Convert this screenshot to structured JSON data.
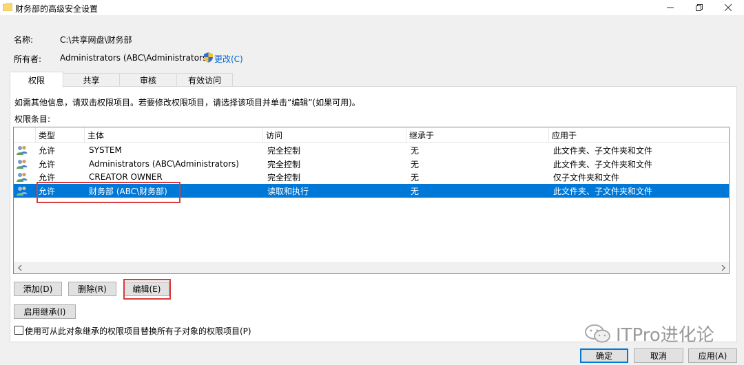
{
  "window": {
    "title": "财务部的高级安全设置"
  },
  "info": {
    "name_label": "名称:",
    "name_value": "C:\\共享网盘\\财务部",
    "owner_label": "所有者:",
    "owner_value": "Administrators (ABC\\Administrators)",
    "change_link": "更改(C)"
  },
  "tabs": [
    {
      "label": "权限"
    },
    {
      "label": "共享"
    },
    {
      "label": "审核"
    },
    {
      "label": "有效访问"
    }
  ],
  "instructions": "如需其他信息，请双击权限项目。若要修改权限项目，请选择该项目并单击“编辑”(如果可用)。",
  "entries_label": "权限条目:",
  "table": {
    "headers": [
      "类型",
      "主体",
      "访问",
      "继承于",
      "应用于"
    ],
    "rows": [
      {
        "type": "允许",
        "principal": "SYSTEM",
        "access": "完全控制",
        "inherited": "无",
        "applies": "此文件夹、子文件夹和文件"
      },
      {
        "type": "允许",
        "principal": "Administrators (ABC\\Administrators)",
        "access": "完全控制",
        "inherited": "无",
        "applies": "此文件夹、子文件夹和文件"
      },
      {
        "type": "允许",
        "principal": "CREATOR OWNER",
        "access": "完全控制",
        "inherited": "无",
        "applies": "仅子文件夹和文件"
      },
      {
        "type": "允许",
        "principal": "财务部 (ABC\\财务部)",
        "access": "读取和执行",
        "inherited": "无",
        "applies": "此文件夹、子文件夹和文件"
      }
    ]
  },
  "buttons": {
    "add": "添加(D)",
    "remove": "删除(R)",
    "edit": "编辑(E)",
    "enable_inheritance": "启用继承(I)",
    "ok": "确定",
    "cancel": "取消",
    "apply": "应用(A)"
  },
  "checkbox_label": "使用可从此对象继承的权限项目替换所有子对象的权限项目(P)",
  "watermark": "ITPro进化论",
  "colors": {
    "selection": "#0078d7",
    "link": "#0066cc",
    "highlight_box": "#d83b3b"
  }
}
